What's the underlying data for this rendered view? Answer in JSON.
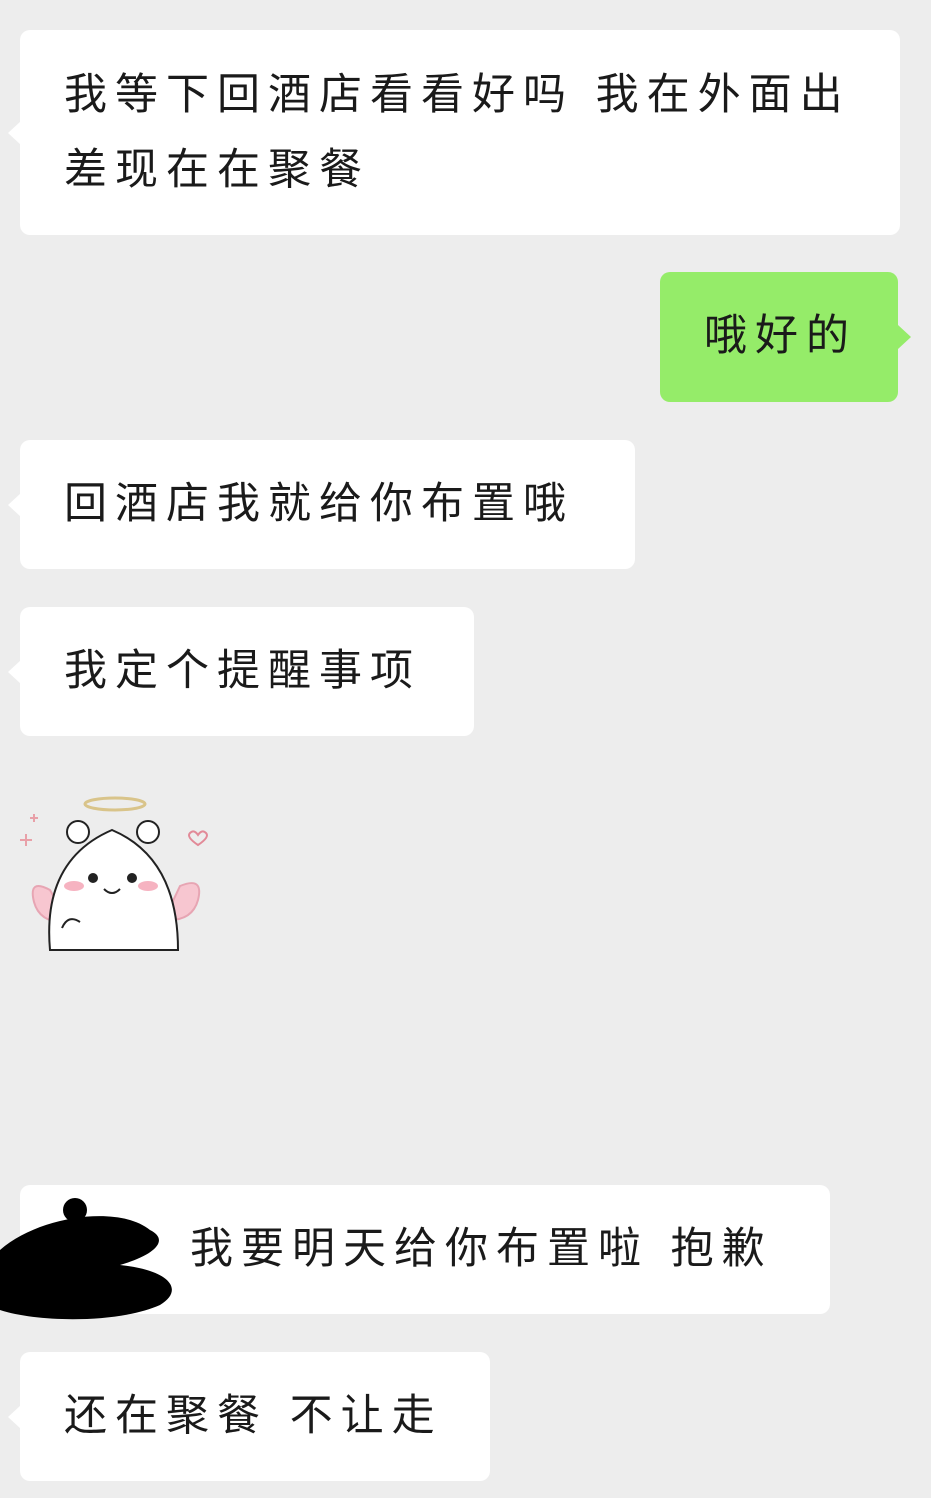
{
  "colors": {
    "background": "#ededed",
    "incoming_bubble": "#ffffff",
    "outgoing_bubble": "#95ec69"
  },
  "messages": [
    {
      "direction": "incoming",
      "text": "我等下回酒店看看好吗 我在外面出差现在在聚餐"
    },
    {
      "direction": "outgoing",
      "text": "哦好的"
    },
    {
      "direction": "incoming",
      "text": "回酒店我就给你布置哦"
    },
    {
      "direction": "incoming",
      "text": "我定个提醒事项"
    },
    {
      "direction": "incoming",
      "type": "sticker",
      "sticker": "angel-hamster-sticker"
    },
    {
      "direction": "incoming",
      "text": "我要明天给你布置啦 抱歉"
    },
    {
      "direction": "incoming",
      "text": "还在聚餐 不让走"
    }
  ]
}
